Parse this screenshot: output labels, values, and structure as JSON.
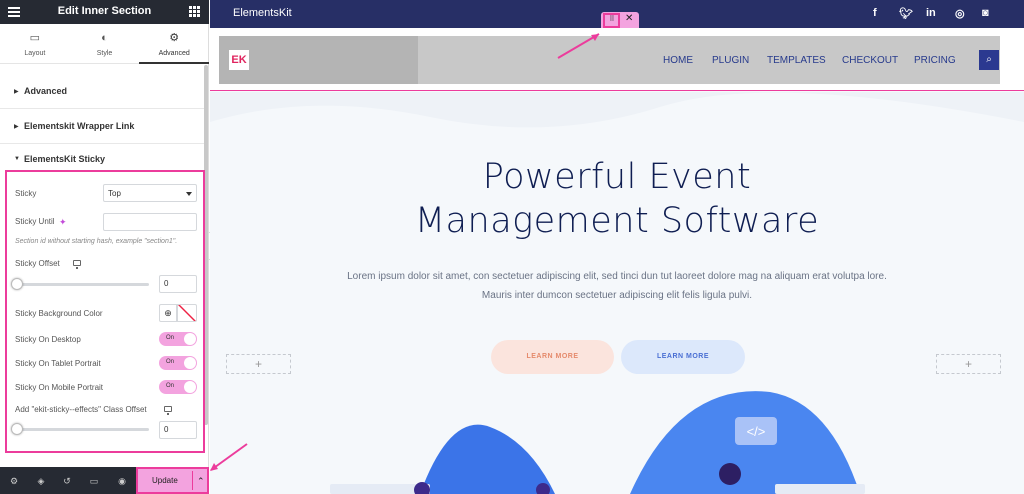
{
  "panel": {
    "title": "Edit Inner Section",
    "tabs": [
      {
        "label": "Layout",
        "icon": "layout-icon"
      },
      {
        "label": "Style",
        "icon": "style-icon"
      },
      {
        "label": "Advanced",
        "icon": "gear-icon",
        "active": true
      }
    ],
    "sections": [
      {
        "label": "Advanced",
        "expanded": false
      },
      {
        "label": "Elementskit Wrapper Link",
        "expanded": false
      },
      {
        "label": "ElementsKit Sticky",
        "expanded": true
      }
    ],
    "sticky": {
      "sticky_label": "Sticky",
      "sticky_value": "Top",
      "until_label": "Sticky Until",
      "until_value": "",
      "until_hint": "Section id without starting hash, example \"section1\".",
      "offset_label": "Sticky Offset",
      "offset_value": "0",
      "offset_slider_fraction": 0,
      "bg_color_label": "Sticky Background Color",
      "desktop_label": "Sticky On Desktop",
      "desktop_toggle": "On",
      "tablet_label": "Sticky On Tablet Portrait",
      "tablet_toggle": "On",
      "mobile_label": "Sticky On Mobile Portrait",
      "mobile_toggle": "On",
      "effects_label": "Add \"ekit-sticky--effects\" Class Offset",
      "effects_value": "0",
      "effects_slider_fraction": 0
    },
    "footer": {
      "update_label": "Update",
      "icons": [
        "settings-icon",
        "layers-icon",
        "history-icon",
        "responsive-icon",
        "preview-icon"
      ]
    }
  },
  "site": {
    "brand": "ElementsKit",
    "social": [
      "facebook-icon",
      "twitter-icon",
      "linkedin-icon",
      "dribbble-icon",
      "instagram-icon"
    ],
    "logo_text": "EK",
    "menu": [
      "HOME",
      "PLUGIN",
      "TEMPLATES",
      "CHECKOUT",
      "PRICING"
    ],
    "hero": {
      "title_line1": "Powerful Event",
      "title_line2": "Management Software",
      "subtitle_line1": "Lorem ipsum dolor sit amet, con sectetuer adipiscing elit, sed tinci dun tut laoreet dolore mag na aliquam erat volutpa lore.",
      "subtitle_line2": "Mauris inter dumcon sectetuer adipiscing elit felis ligula pulvi.",
      "cta_primary": "LEARN MORE",
      "cta_secondary": "LEARN MORE"
    }
  },
  "colors": {
    "panel_dark": "#262a33",
    "highlight_pink": "#ec3c9c",
    "toggle_pink": "#f3a3df",
    "topbar_navy": "#272f66",
    "hero_title": "#0f1e52"
  }
}
